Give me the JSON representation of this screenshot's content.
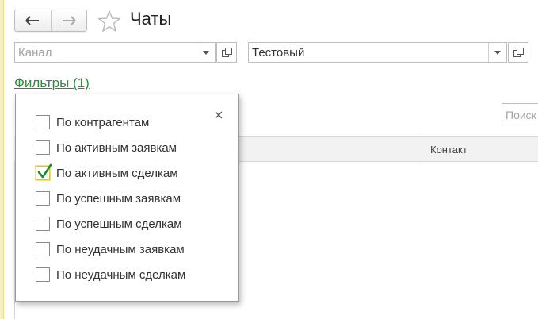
{
  "header": {
    "title": "Чаты"
  },
  "filters": {
    "channel": {
      "placeholder": "Канал",
      "value": ""
    },
    "account": {
      "value": "Тестовый"
    },
    "link_label": "Фильтры (1)"
  },
  "list": {
    "search_placeholder": "Поиск",
    "columns": [
      "Контакт"
    ]
  },
  "popup": {
    "close_symbol": "×",
    "options": [
      {
        "label": "По контрагентам",
        "checked": false
      },
      {
        "label": "По активным заявкам",
        "checked": false
      },
      {
        "label": "По активным сделкам",
        "checked": true
      },
      {
        "label": "По успешным заявкам",
        "checked": false
      },
      {
        "label": "По успешным сделкам",
        "checked": false
      },
      {
        "label": "По неудачным заявкам",
        "checked": false
      },
      {
        "label": "По неудачным сделкам",
        "checked": false
      }
    ]
  },
  "colors": {
    "link": "#2e8b3c",
    "checkmark": "#1e8a2e",
    "highlight": "#efe08a"
  }
}
